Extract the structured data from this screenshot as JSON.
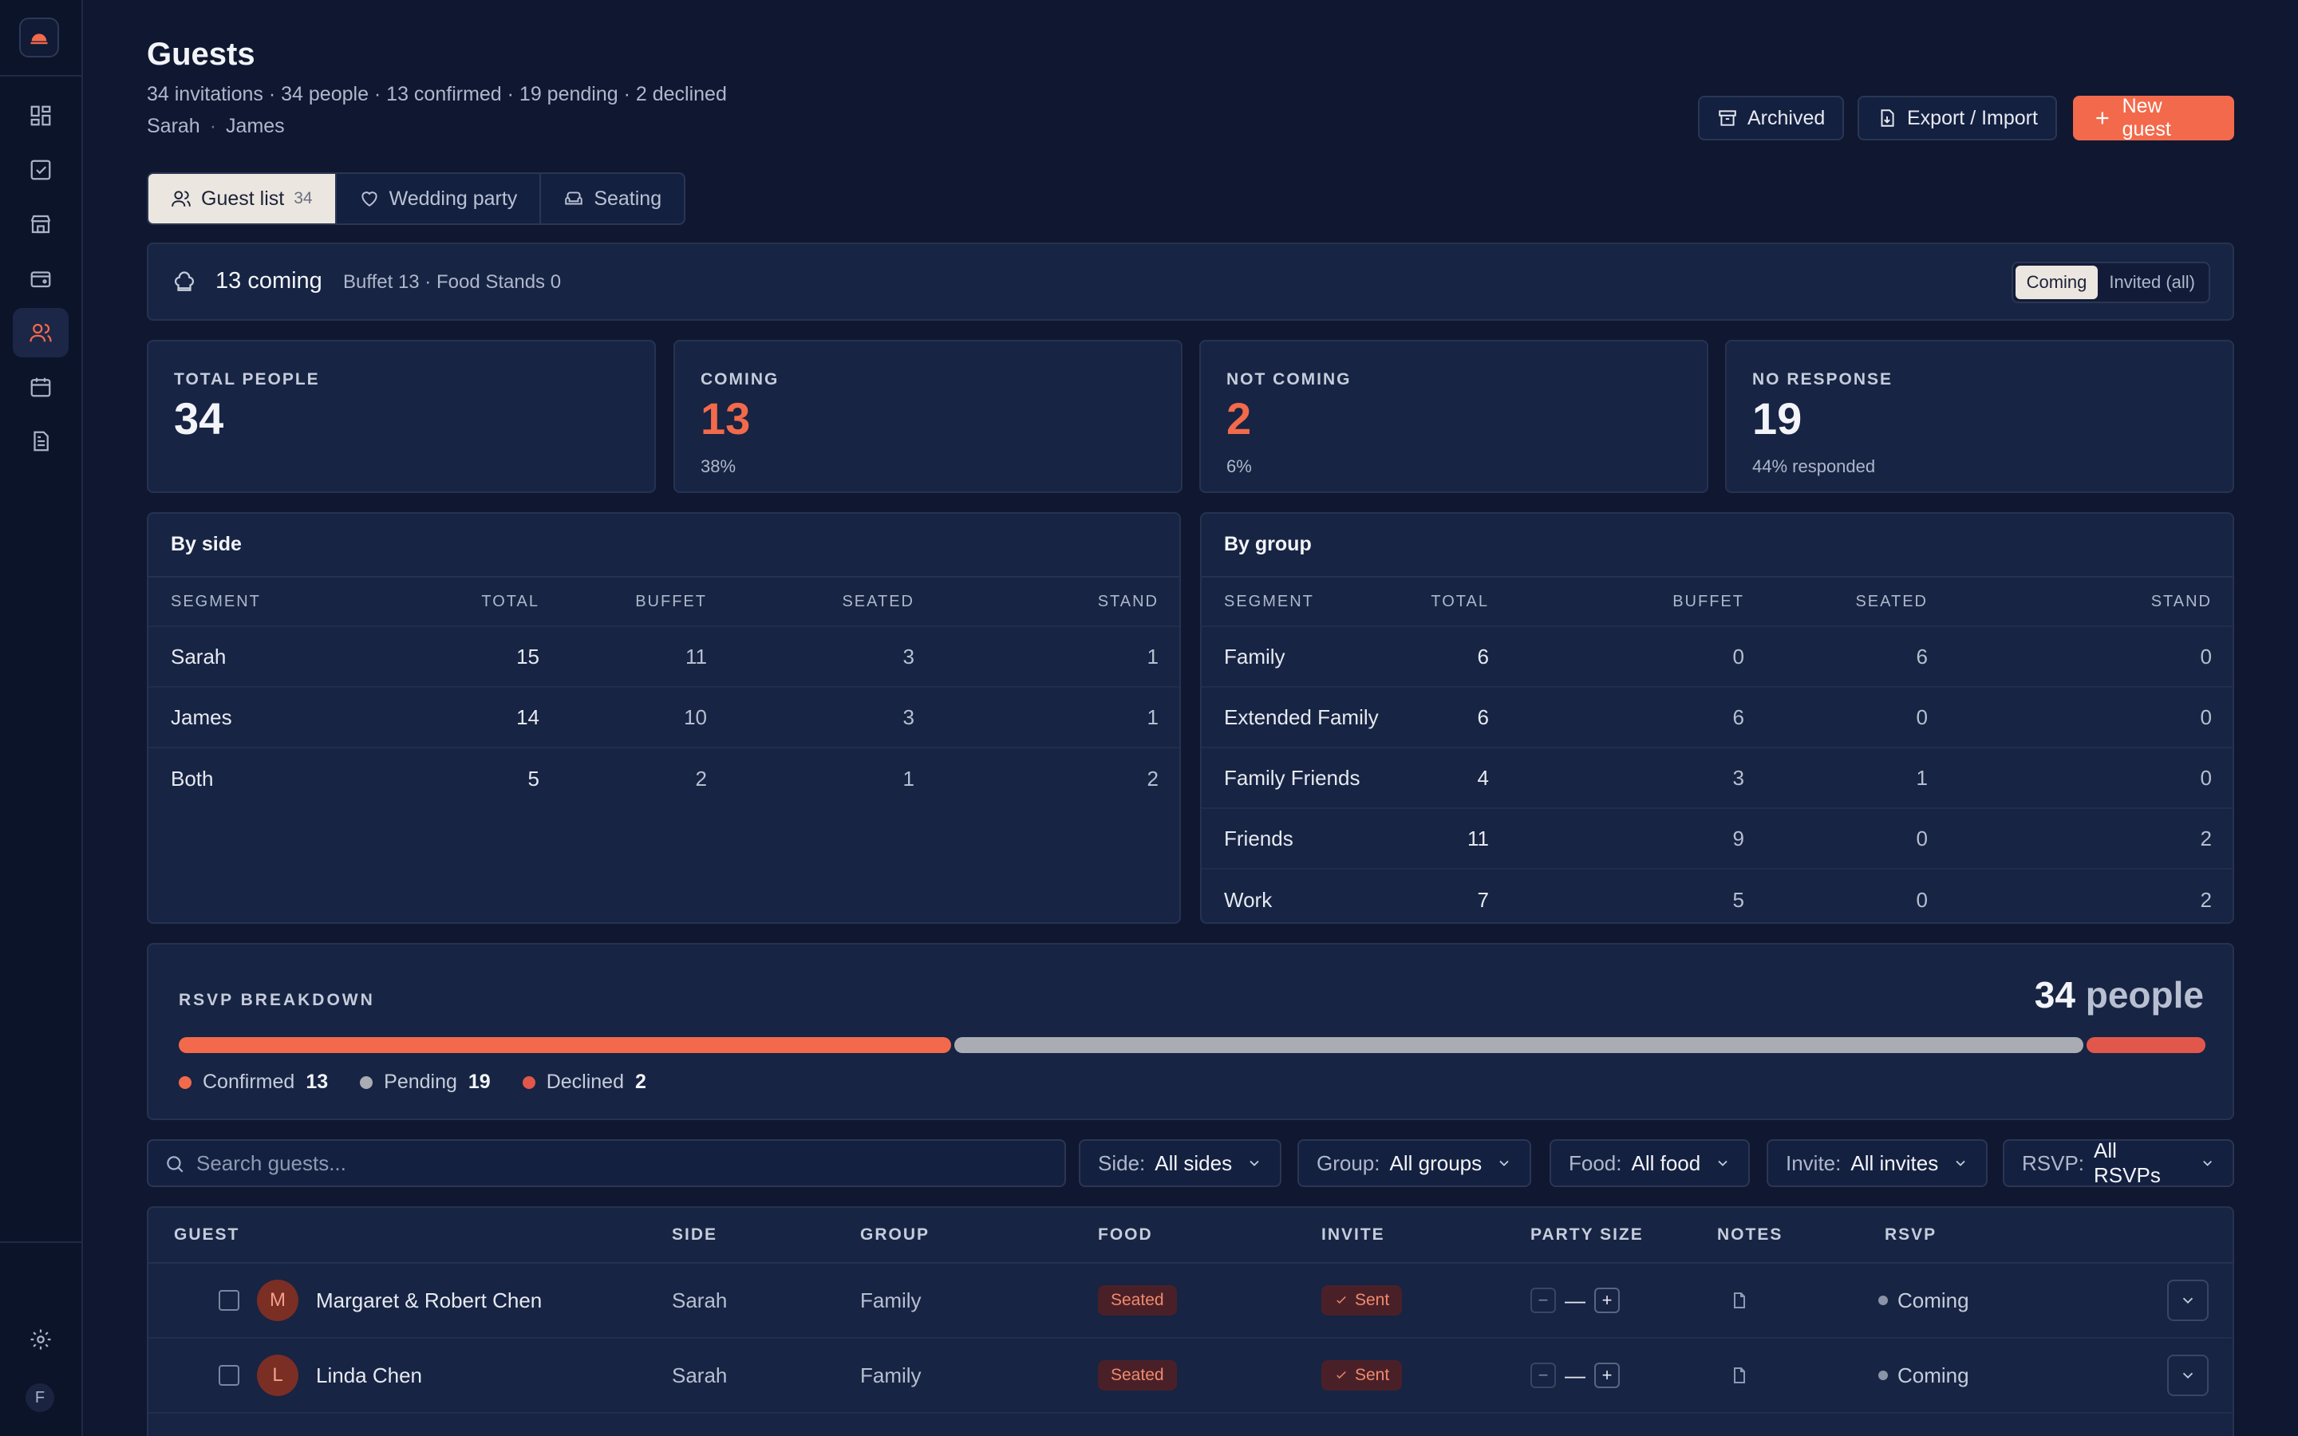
{
  "header": {
    "title": "Guests",
    "subtitle": "34 invitations · 34 people · 13 confirmed · 19 pending · 2 declined",
    "partner_a": "Sarah",
    "partner_b": "James",
    "separator": "·",
    "archived_label": "Archived",
    "export_label": "Export / Import",
    "new_guest_label": "New guest"
  },
  "tabs": [
    {
      "label": "Guest list",
      "count": "34"
    },
    {
      "label": "Wedding party"
    },
    {
      "label": "Seating"
    }
  ],
  "coming_bar": {
    "label": "13 coming",
    "detail": "Buffet 13 · Food Stands 0",
    "toggle": [
      "Coming",
      "Invited (all)"
    ]
  },
  "stats": [
    {
      "label": "TOTAL PEOPLE",
      "value": "34",
      "sub": ""
    },
    {
      "label": "COMING",
      "value": "13",
      "sub": "38%"
    },
    {
      "label": "NOT COMING",
      "value": "2",
      "sub": "6%"
    },
    {
      "label": "NO RESPONSE",
      "value": "19",
      "sub": "44% responded"
    }
  ],
  "by_side": {
    "title": "By side",
    "columns": [
      "SEGMENT",
      "TOTAL",
      "BUFFET",
      "SEATED",
      "STAND"
    ],
    "rows": [
      [
        "Sarah",
        "15",
        "11",
        "3",
        "1"
      ],
      [
        "James",
        "14",
        "10",
        "3",
        "1"
      ],
      [
        "Both",
        "5",
        "2",
        "1",
        "2"
      ]
    ]
  },
  "by_group": {
    "title": "By group",
    "columns": [
      "SEGMENT",
      "TOTAL",
      "BUFFET",
      "SEATED",
      "STAND"
    ],
    "rows": [
      [
        "Family",
        "6",
        "0",
        "6",
        "0"
      ],
      [
        "Extended Family",
        "6",
        "6",
        "0",
        "0"
      ],
      [
        "Family Friends",
        "4",
        "3",
        "1",
        "0"
      ],
      [
        "Friends",
        "11",
        "9",
        "0",
        "2"
      ],
      [
        "Work",
        "7",
        "5",
        "0",
        "2"
      ]
    ]
  },
  "rsvp": {
    "title": "RSVP BREAKDOWN",
    "total_value": "34",
    "total_unit": "people",
    "segments": [
      {
        "label": "Confirmed",
        "value": 13,
        "color": "#f26a4b"
      },
      {
        "label": "Pending",
        "value": 19,
        "color": "#a9acb3"
      },
      {
        "label": "Declined",
        "value": 2,
        "color": "#e2574c"
      }
    ]
  },
  "filters": {
    "search_placeholder": "Search guests...",
    "side": {
      "label": "Side:",
      "value": "All sides"
    },
    "group": {
      "label": "Group:",
      "value": "All groups"
    },
    "food": {
      "label": "Food:",
      "value": "All food"
    },
    "invite": {
      "label": "Invite:",
      "value": "All invites"
    },
    "rsvp": {
      "label": "RSVP:",
      "value": "All RSVPs"
    }
  },
  "guest_table": {
    "columns": [
      "GUEST",
      "SIDE",
      "GROUP",
      "FOOD",
      "INVITE",
      "PARTY SIZE",
      "NOTES",
      "RSVP"
    ],
    "rows": [
      {
        "initial": "M",
        "name": "Margaret & Robert Chen",
        "side": "Sarah",
        "group": "Family",
        "food": "Seated",
        "invite": "Sent",
        "party": "—",
        "rsvp": "Coming"
      },
      {
        "initial": "L",
        "name": "Linda Chen",
        "side": "Sarah",
        "group": "Family",
        "food": "Seated",
        "invite": "Sent",
        "party": "—",
        "rsvp": "Coming"
      }
    ]
  },
  "user_initial": "F",
  "colors": {
    "accent": "#f26a4b",
    "background": "#0f1830",
    "panel": "#172443"
  }
}
